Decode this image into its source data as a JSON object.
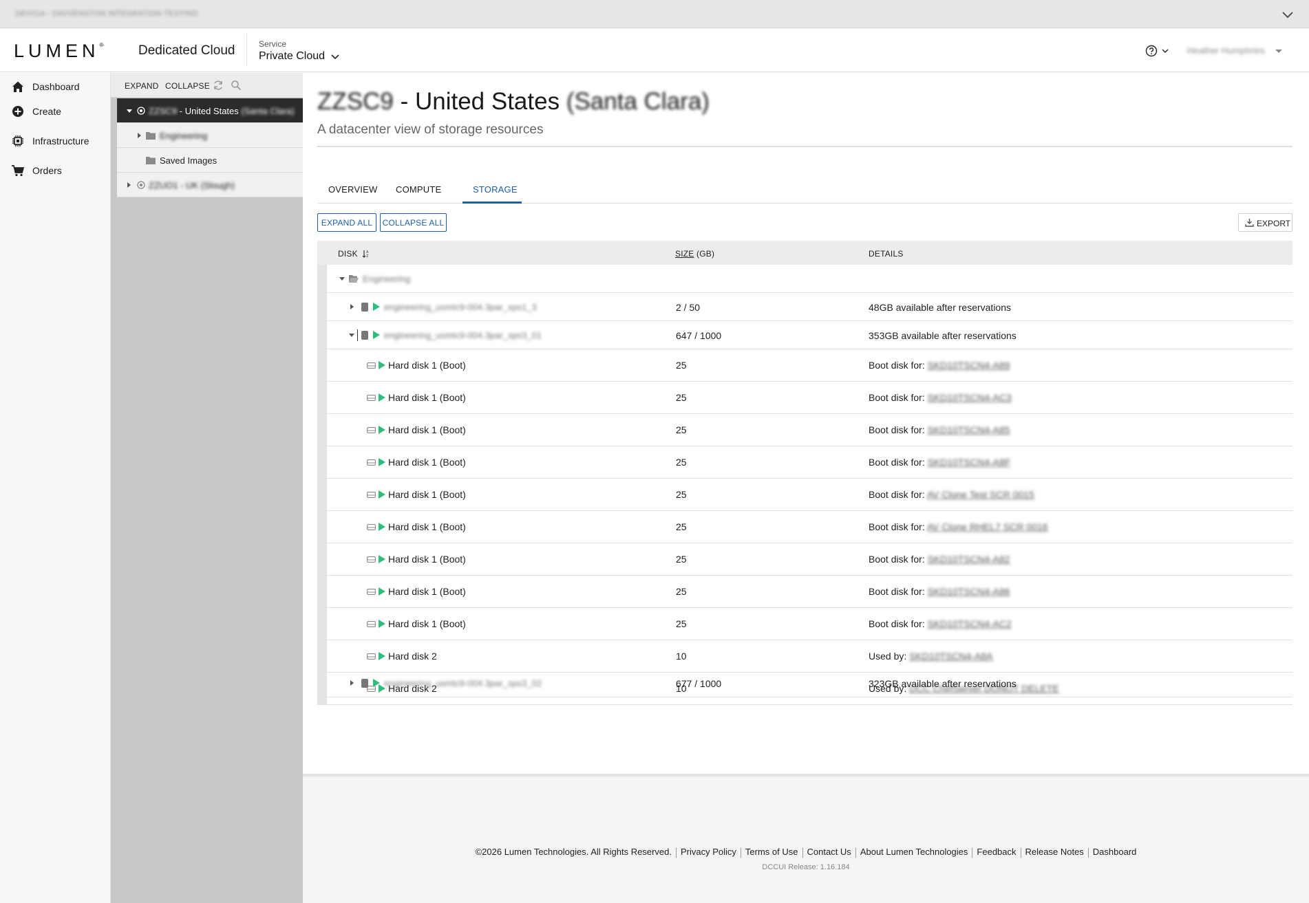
{
  "env_banner": "DEV01A - DAVVENSTON INTEGRATION TESTING",
  "header": {
    "logo": "LUMEN",
    "logo_mark": "®",
    "product": "Dedicated Cloud",
    "service_label": "Service",
    "service_value": "Private Cloud",
    "user_name": "Heather Humphries"
  },
  "nav": {
    "items": [
      {
        "label": "Dashboard",
        "icon": "home-icon"
      },
      {
        "label": "Create",
        "icon": "plus-circle-icon"
      },
      {
        "label": "Infrastructure",
        "icon": "chip-icon"
      },
      {
        "label": "Orders",
        "icon": "cart-icon"
      }
    ]
  },
  "tree": {
    "expand": "EXPAND",
    "collapse": "COLLAPSE",
    "rows": [
      {
        "prefix": "ZZSC9",
        "label": " - United States",
        "suffix": "(Santa Clara)"
      },
      {
        "label": "Engineering"
      },
      {
        "label": "Saved Images"
      },
      {
        "label": "ZZUO1 - UK (Slough)"
      }
    ]
  },
  "page": {
    "title_prefix": "ZZSC9",
    "title_main": " - United States ",
    "title_suffix": "(Santa Clara)",
    "subtitle": "A datacenter view of storage resources",
    "tabs": [
      "OVERVIEW",
      "COMPUTE",
      "STORAGE"
    ],
    "active_tab": "STORAGE"
  },
  "actions": {
    "expand_all": "EXPAND ALL",
    "collapse_all": "COLLAPSE ALL",
    "export": "EXPORT"
  },
  "table": {
    "columns": {
      "disk": "DISK",
      "size_u": "SIZE",
      "size_rest": " (GB)",
      "details": "DETAILS"
    },
    "group": "Engineering",
    "datastores": [
      {
        "name": "engineering_usmtc9-004.3par_sps1_3",
        "size": "2 / 50",
        "details": "48GB available after reservations"
      },
      {
        "name": "engineering_usmtc9-004.3par_sps3_01",
        "size": "647 / 1000",
        "details": "353GB available after reservations"
      },
      {
        "name": "engineering_usmtc9-004.3par_sps3_02",
        "size": "677 / 1000",
        "details": "323GB available after reservations"
      }
    ],
    "disks": [
      {
        "name": "Hard disk 1 (Boot)",
        "size": "25",
        "prefix": "Boot disk for:",
        "target": "SKD10TSCN4-A89"
      },
      {
        "name": "Hard disk 1 (Boot)",
        "size": "25",
        "prefix": "Boot disk for:",
        "target": "SKD10TSCN4-AC3"
      },
      {
        "name": "Hard disk 1 (Boot)",
        "size": "25",
        "prefix": "Boot disk for:",
        "target": "SKD10TSCN4-A85"
      },
      {
        "name": "Hard disk 1 (Boot)",
        "size": "25",
        "prefix": "Boot disk for:",
        "target": "SKD10TSCN4-A8F"
      },
      {
        "name": "Hard disk 1 (Boot)",
        "size": "25",
        "prefix": "Boot disk for:",
        "target": "AV Clone Test SCR 0015"
      },
      {
        "name": "Hard disk 1 (Boot)",
        "size": "25",
        "prefix": "Boot disk for:",
        "target": "AV Clone RHEL7 SCR 0016"
      },
      {
        "name": "Hard disk 1 (Boot)",
        "size": "25",
        "prefix": "Boot disk for:",
        "target": "SKD10TSCN4-A82"
      },
      {
        "name": "Hard disk 1 (Boot)",
        "size": "25",
        "prefix": "Boot disk for:",
        "target": "SKD10TSCN4-A86"
      },
      {
        "name": "Hard disk 1 (Boot)",
        "size": "25",
        "prefix": "Boot disk for:",
        "target": "SKD10TSCN4-AC2"
      },
      {
        "name": "Hard disk 2",
        "size": "10",
        "prefix": "Used by:",
        "target": "SKD10TSCN4-A8A"
      },
      {
        "name": "Hard disk 2",
        "size": "10",
        "prefix": "Used by:",
        "target": "DCC ChefServer DONOT DELETE"
      }
    ]
  },
  "footer": {
    "copyright": "©2026 Lumen Technologies. All Rights Reserved.",
    "links": [
      "Privacy Policy",
      "Terms of Use",
      "Contact Us",
      "About Lumen Technologies",
      "Feedback",
      "Release Notes",
      "Dashboard"
    ],
    "release": "DCCUI Release: 1.16.184"
  },
  "colors": {
    "accent": "#1d5fa8",
    "status_green": "#2fbd7a",
    "tree_selected": "#2b2b2b"
  }
}
